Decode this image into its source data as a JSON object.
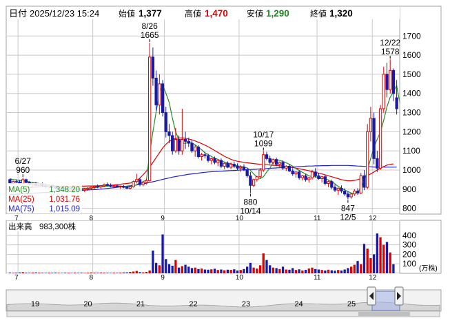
{
  "header": {
    "date_label": "日付",
    "datetime": "2025/12/23 15:24",
    "open_label": "始値",
    "open_value": "1,377",
    "high_label": "高値",
    "high_value": "1,470",
    "low_label": "安値",
    "low_value": "1,290",
    "close_label": "終値",
    "close_value": "1,320"
  },
  "colors": {
    "up": "#dd0000",
    "down": "#1a1aa6",
    "ma5": "#2a8a2a",
    "ma25": "#dd0000",
    "ma75": "#2222cc",
    "grid": "#c8c8c8",
    "nav_fill": "#d6d6d6",
    "nav_line": "#9a9a9a",
    "nav_window": "#a8b8e8"
  },
  "legend": {
    "ma5": {
      "label": "MA(5)",
      "value": "1,348.20"
    },
    "ma25": {
      "label": "MA(25)",
      "value": "1,031.76"
    },
    "ma75": {
      "label": "MA(75)",
      "value": "1,015.09"
    }
  },
  "volume": {
    "label": "出来高",
    "value": "983,300株",
    "unit": "(万株)"
  },
  "navigator": {
    "labels": [
      "19",
      "20",
      "21",
      "22",
      "23",
      "24",
      "25"
    ],
    "scroll_left_icon": "arrow-left-icon",
    "scroll_right_icon": "arrow-right-icon"
  },
  "chart_data": {
    "type": "candlestick",
    "price_axis": {
      "ticks": [
        "800",
        "900",
        "1000",
        "1100",
        "1200",
        "1300",
        "1400",
        "1500",
        "1600",
        "1700"
      ],
      "ylim": [
        770,
        1780
      ]
    },
    "volume_axis": {
      "ticks": [
        "100",
        "200",
        "300",
        "400"
      ],
      "ylim": [
        0,
        450
      ]
    },
    "month_labels": [
      "7",
      "8",
      "9",
      "10",
      "11",
      "12"
    ],
    "annotations": [
      {
        "date": "6/27",
        "value": "960"
      },
      {
        "date": "8/26",
        "value": "1665"
      },
      {
        "date": "10/17",
        "value": "1099"
      },
      {
        "value": "880",
        "date": "10/14"
      },
      {
        "value": "847",
        "date": "12/5"
      },
      {
        "date": "12/22",
        "value": "1578"
      }
    ],
    "candles": [
      [
        950,
        955,
        925,
        930
      ],
      [
        930,
        945,
        925,
        940
      ],
      [
        940,
        952,
        932,
        938
      ],
      [
        938,
        948,
        925,
        930
      ],
      [
        930,
        960,
        925,
        950
      ],
      [
        950,
        955,
        930,
        935
      ],
      [
        935,
        942,
        920,
        925
      ],
      [
        925,
        935,
        910,
        930
      ],
      [
        930,
        938,
        915,
        920
      ],
      [
        920,
        930,
        910,
        925
      ],
      [
        925,
        935,
        915,
        918
      ],
      [
        918,
        928,
        905,
        912
      ],
      [
        912,
        925,
        905,
        920
      ],
      [
        920,
        926,
        908,
        910
      ],
      [
        910,
        918,
        898,
        905
      ],
      [
        905,
        915,
        895,
        912
      ],
      [
        912,
        922,
        900,
        905
      ],
      [
        905,
        912,
        892,
        898
      ],
      [
        898,
        910,
        890,
        905
      ],
      [
        905,
        912,
        895,
        900
      ],
      [
        900,
        910,
        890,
        902
      ],
      [
        902,
        912,
        895,
        898
      ],
      [
        898,
        905,
        888,
        895
      ],
      [
        895,
        905,
        885,
        900
      ],
      [
        900,
        910,
        892,
        905
      ],
      [
        905,
        915,
        898,
        910
      ],
      [
        910,
        920,
        902,
        915
      ],
      [
        915,
        925,
        905,
        912
      ],
      [
        912,
        922,
        902,
        918
      ],
      [
        918,
        930,
        910,
        925
      ],
      [
        925,
        935,
        915,
        920
      ],
      [
        920,
        930,
        910,
        915
      ],
      [
        915,
        922,
        905,
        918
      ],
      [
        918,
        925,
        908,
        912
      ],
      [
        912,
        920,
        902,
        915
      ],
      [
        915,
        922,
        905,
        910
      ],
      [
        910,
        918,
        900,
        905
      ],
      [
        905,
        915,
        898,
        912
      ],
      [
        912,
        945,
        908,
        940
      ],
      [
        940,
        980,
        930,
        950
      ],
      [
        950,
        960,
        915,
        925
      ],
      [
        925,
        940,
        915,
        935
      ],
      [
        935,
        955,
        925,
        945
      ],
      [
        945,
        1665,
        940,
        1590
      ],
      [
        1590,
        1640,
        1440,
        1480
      ],
      [
        1480,
        1520,
        1310,
        1340
      ],
      [
        1340,
        1500,
        1290,
        1450
      ],
      [
        1450,
        1470,
        1280,
        1300
      ],
      [
        1300,
        1330,
        1170,
        1200
      ],
      [
        1200,
        1240,
        1140,
        1180
      ],
      [
        1180,
        1200,
        1080,
        1100
      ],
      [
        1100,
        1220,
        1090,
        1160
      ],
      [
        1160,
        1180,
        1080,
        1100
      ],
      [
        1100,
        1320,
        1080,
        1160
      ],
      [
        1160,
        1200,
        1110,
        1150
      ],
      [
        1150,
        1170,
        1120,
        1140
      ],
      [
        1140,
        1155,
        1090,
        1100
      ],
      [
        1100,
        1130,
        1070,
        1120
      ],
      [
        1120,
        1130,
        1060,
        1070
      ],
      [
        1070,
        1090,
        1050,
        1080
      ],
      [
        1080,
        1095,
        1060,
        1075
      ],
      [
        1075,
        1085,
        1040,
        1050
      ],
      [
        1050,
        1065,
        1030,
        1060
      ],
      [
        1060,
        1070,
        1030,
        1040
      ],
      [
        1040,
        1055,
        1020,
        1050
      ],
      [
        1050,
        1060,
        1010,
        1020
      ],
      [
        1020,
        1040,
        1005,
        1035
      ],
      [
        1035,
        1045,
        1010,
        1015
      ],
      [
        1015,
        1040,
        1005,
        1030
      ],
      [
        1030,
        1045,
        1010,
        1020
      ],
      [
        1020,
        1035,
        1000,
        1010
      ],
      [
        1010,
        1025,
        990,
        1015
      ],
      [
        1015,
        1030,
        995,
        1000
      ],
      [
        1000,
        1012,
        960,
        970
      ],
      [
        970,
        990,
        880,
        920
      ],
      [
        920,
        955,
        910,
        950
      ],
      [
        950,
        970,
        940,
        965
      ],
      [
        965,
        1010,
        955,
        1000
      ],
      [
        1000,
        1099,
        990,
        1080
      ],
      [
        1080,
        1095,
        1050,
        1060
      ],
      [
        1060,
        1075,
        1030,
        1040
      ],
      [
        1040,
        1060,
        1030,
        1055
      ],
      [
        1055,
        1065,
        1020,
        1030
      ],
      [
        1030,
        1045,
        1010,
        1040
      ],
      [
        1040,
        1050,
        1000,
        1010
      ],
      [
        1010,
        1025,
        995,
        1020
      ],
      [
        1020,
        1030,
        990,
        995
      ],
      [
        995,
        1010,
        970,
        980
      ],
      [
        980,
        995,
        960,
        990
      ],
      [
        990,
        1000,
        950,
        960
      ],
      [
        960,
        975,
        945,
        970
      ],
      [
        970,
        980,
        940,
        950
      ],
      [
        950,
        965,
        935,
        960
      ],
      [
        960,
        1000,
        950,
        990
      ],
      [
        990,
        1010,
        960,
        970
      ],
      [
        970,
        985,
        950,
        955
      ],
      [
        955,
        970,
        935,
        965
      ],
      [
        965,
        975,
        920,
        930
      ],
      [
        930,
        945,
        910,
        940
      ],
      [
        940,
        950,
        900,
        910
      ],
      [
        910,
        925,
        885,
        895
      ],
      [
        895,
        910,
        870,
        905
      ],
      [
        905,
        920,
        880,
        890
      ],
      [
        890,
        905,
        865,
        875
      ],
      [
        875,
        890,
        847,
        860
      ],
      [
        860,
        880,
        850,
        875
      ],
      [
        875,
        900,
        865,
        890
      ],
      [
        890,
        905,
        870,
        880
      ],
      [
        880,
        985,
        875,
        970
      ],
      [
        970,
        1000,
        895,
        910
      ],
      [
        910,
        1240,
        900,
        1200
      ],
      [
        1200,
        1330,
        1150,
        1270
      ],
      [
        1270,
        1300,
        1030,
        1060
      ],
      [
        1060,
        1100,
        990,
        1010
      ],
      [
        1010,
        1340,
        1000,
        1320
      ],
      [
        1320,
        1540,
        1300,
        1500
      ],
      [
        1500,
        1560,
        1380,
        1420
      ],
      [
        1420,
        1578,
        1400,
        1520
      ],
      [
        1520,
        1530,
        1360,
        1400
      ],
      [
        1377,
        1470,
        1290,
        1320
      ]
    ],
    "ma5": [
      955,
      950,
      948,
      946,
      944,
      942,
      938,
      935,
      932,
      930,
      928,
      925,
      922,
      920,
      918,
      915,
      913,
      911,
      910,
      908,
      907,
      906,
      905,
      905,
      906,
      907,
      908,
      910,
      912,
      914,
      916,
      917,
      917,
      917,
      916,
      915,
      914,
      913,
      916,
      924,
      932,
      940,
      948,
      1090,
      1200,
      1305,
      1395,
      1445,
      1400,
      1354,
      1270,
      1200,
      1158,
      1140,
      1140,
      1144,
      1142,
      1132,
      1118,
      1106,
      1090,
      1081,
      1071,
      1063,
      1056,
      1048,
      1042,
      1037,
      1033,
      1028,
      1022,
      1019,
      1016,
      1011,
      999,
      980,
      963,
      955,
      965,
      990,
      1010,
      1040,
      1055,
      1050,
      1045,
      1038,
      1030,
      1020,
      1008,
      998,
      988,
      980,
      970,
      966,
      965,
      962,
      960,
      955,
      948,
      940,
      928,
      915,
      905,
      896,
      888,
      880,
      878,
      882,
      910,
      940,
      1000,
      1060,
      1120,
      1160,
      1200,
      1260,
      1330,
      1380,
      1410,
      1440,
      1348
    ],
    "ma25": [
      900,
      902,
      904,
      905,
      906,
      908,
      909,
      910,
      911,
      912,
      912,
      913,
      913,
      914,
      914,
      914,
      915,
      915,
      915,
      916,
      916,
      916,
      916,
      916,
      917,
      917,
      917,
      918,
      918,
      919,
      920,
      921,
      922,
      924,
      926,
      928,
      930,
      932,
      936,
      945,
      958,
      975,
      995,
      1015,
      1040,
      1065,
      1090,
      1115,
      1135,
      1150,
      1160,
      1165,
      1168,
      1168,
      1166,
      1162,
      1158,
      1152,
      1145,
      1138,
      1130,
      1122,
      1112,
      1102,
      1092,
      1082,
      1072,
      1064,
      1056,
      1050,
      1046,
      1043,
      1040,
      1038,
      1036,
      1034,
      1032,
      1030,
      1029,
      1028,
      1026,
      1025,
      1024,
      1022,
      1020,
      1018,
      1016,
      1013,
      1010,
      1007,
      1004,
      1000,
      996,
      992,
      988,
      984,
      980,
      975,
      970,
      965,
      960,
      955,
      950,
      946,
      944,
      944,
      946,
      950,
      956,
      962,
      970,
      980,
      990,
      1000,
      1010,
      1018,
      1026,
      1030,
      1032
    ],
    "ma75": [
      872,
      873,
      874,
      875,
      876,
      877,
      878,
      879,
      880,
      881,
      882,
      883,
      884,
      885,
      886,
      887,
      888,
      889,
      890,
      891,
      892,
      893,
      894,
      895,
      896,
      897,
      898,
      899,
      900,
      902,
      904,
      906,
      908,
      910,
      912,
      914,
      916,
      918,
      920,
      922,
      925,
      928,
      931,
      935,
      939,
      943,
      947,
      951,
      955,
      959,
      963,
      966,
      969,
      972,
      975,
      978,
      980,
      982,
      984,
      986,
      988,
      990,
      991,
      992,
      993,
      994,
      995,
      996,
      997,
      998,
      999,
      1000,
      1001,
      1002,
      1003,
      1004,
      1005,
      1006,
      1007,
      1008,
      1009,
      1010,
      1011,
      1012,
      1013,
      1014,
      1015,
      1016,
      1017,
      1018,
      1019,
      1020,
      1021,
      1021,
      1022,
      1022,
      1023,
      1023,
      1023,
      1024,
      1024,
      1024,
      1024,
      1024,
      1024,
      1023,
      1022,
      1021,
      1020,
      1019,
      1018,
      1017,
      1016,
      1015,
      1015,
      1015,
      1015,
      1015,
      1015,
      1015
    ],
    "volumes": [
      8,
      6,
      7,
      9,
      12,
      7,
      6,
      8,
      9,
      7,
      6,
      5,
      7,
      6,
      8,
      6,
      5,
      7,
      6,
      5,
      8,
      6,
      7,
      5,
      6,
      9,
      7,
      6,
      8,
      7,
      6,
      5,
      7,
      6,
      8,
      9,
      10,
      14,
      18,
      25,
      12,
      10,
      15,
      30,
      240,
      110,
      85,
      410,
      150,
      95,
      80,
      140,
      60,
      75,
      90,
      70,
      55,
      60,
      45,
      50,
      40,
      38,
      42,
      48,
      35,
      40,
      32,
      38,
      36,
      42,
      30,
      35,
      45,
      70,
      110,
      60,
      50,
      85,
      210,
      140,
      85,
      60,
      55,
      45,
      70,
      40,
      38,
      55,
      35,
      42,
      30,
      36,
      50,
      60,
      45,
      40,
      35,
      30,
      38,
      32,
      28,
      35,
      30,
      40,
      55,
      70,
      90,
      130,
      95,
      310,
      260,
      160,
      200,
      420,
      380,
      300,
      330,
      220,
      95
    ]
  }
}
